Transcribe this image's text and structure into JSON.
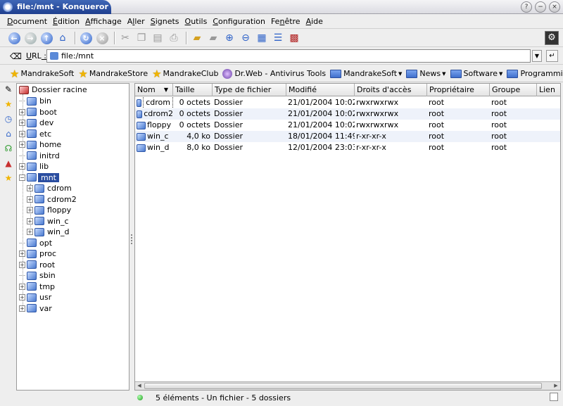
{
  "window": {
    "title": "file:/mnt - Konqueror",
    "buttons": [
      "?",
      "−",
      "×"
    ]
  },
  "menu": [
    {
      "label": "Document",
      "mn": "D"
    },
    {
      "label": "Édition",
      "mn": "É"
    },
    {
      "label": "Affichage",
      "mn": "A"
    },
    {
      "label": "Aller",
      "mn": "l"
    },
    {
      "label": "Signets",
      "mn": "S"
    },
    {
      "label": "Outils",
      "mn": "O"
    },
    {
      "label": "Configuration",
      "mn": "C"
    },
    {
      "label": "Fenêtre",
      "mn": "n"
    },
    {
      "label": "Aide",
      "mn": "A"
    }
  ],
  "url": {
    "label": "URL",
    "label_suffix": " :",
    "value": "file:/mnt"
  },
  "bookmarks": [
    {
      "label": "MandrakeSoft",
      "icon": "star"
    },
    {
      "label": "MandrakeStore",
      "icon": "star"
    },
    {
      "label": "MandrakeClub",
      "icon": "star"
    },
    {
      "label": "Dr.Web - Antivirus Tools",
      "icon": "web"
    },
    {
      "label": "MandrakeSoft",
      "icon": "folder",
      "menu": true
    },
    {
      "label": "News",
      "icon": "folder",
      "menu": true
    },
    {
      "label": "Software",
      "icon": "folder",
      "menu": true
    },
    {
      "label": "Programming",
      "icon": "folder",
      "menu": true
    }
  ],
  "tree": {
    "root": "Dossier racine",
    "items": [
      {
        "label": "bin",
        "expandable": false
      },
      {
        "label": "boot",
        "expandable": true
      },
      {
        "label": "dev",
        "expandable": true
      },
      {
        "label": "etc",
        "expandable": true
      },
      {
        "label": "home",
        "expandable": true
      },
      {
        "label": "initrd",
        "expandable": false
      },
      {
        "label": "lib",
        "expandable": true
      },
      {
        "label": "mnt",
        "expandable": true,
        "expanded": true,
        "selected": true
      },
      {
        "label": "cdrom",
        "expandable": true,
        "child": true
      },
      {
        "label": "cdrom2",
        "expandable": true,
        "child": true
      },
      {
        "label": "floppy",
        "expandable": true,
        "child": true
      },
      {
        "label": "win_c",
        "expandable": true,
        "child": true
      },
      {
        "label": "win_d",
        "expandable": true,
        "child": true
      },
      {
        "label": "opt",
        "expandable": false
      },
      {
        "label": "proc",
        "expandable": true
      },
      {
        "label": "root",
        "expandable": true
      },
      {
        "label": "sbin",
        "expandable": false
      },
      {
        "label": "tmp",
        "expandable": true
      },
      {
        "label": "usr",
        "expandable": true
      },
      {
        "label": "var",
        "expandable": true
      }
    ]
  },
  "columns": [
    "Nom",
    "Taille",
    "Type de fichier",
    "Modifié",
    "Droits d'accès",
    "Propriétaire",
    "Groupe",
    "Lien"
  ],
  "files": [
    {
      "name": "cdrom",
      "size": "0 octets",
      "type": "Dossier",
      "modified": "21/01/2004 10:02",
      "perms": "rwxrwxrwx",
      "owner": "root",
      "group": "root"
    },
    {
      "name": "cdrom2",
      "size": "0 octets",
      "type": "Dossier",
      "modified": "21/01/2004 10:02",
      "perms": "rwxrwxrwx",
      "owner": "root",
      "group": "root"
    },
    {
      "name": "floppy",
      "size": "0 octets",
      "type": "Dossier",
      "modified": "21/01/2004 10:02",
      "perms": "rwxrwxrwx",
      "owner": "root",
      "group": "root"
    },
    {
      "name": "win_c",
      "size": "4,0 ko",
      "type": "Dossier",
      "modified": "18/01/2004 11:49",
      "perms": "r-xr-xr-x",
      "owner": "root",
      "group": "root"
    },
    {
      "name": "win_d",
      "size": "8,0 ko",
      "type": "Dossier",
      "modified": "12/01/2004 23:03",
      "perms": "r-xr-xr-x",
      "owner": "root",
      "group": "root"
    }
  ],
  "status": {
    "text": "5 éléments - Un fichier - 5 dossiers"
  },
  "colors": {
    "title": "#2a4da0",
    "selection": "#2a4da0",
    "alt_row": "#eef2fa"
  }
}
